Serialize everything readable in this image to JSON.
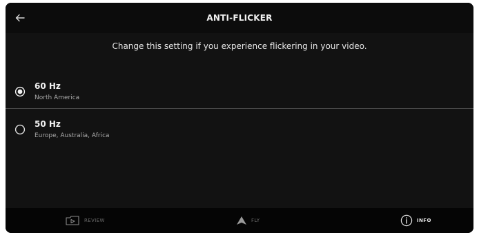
{
  "header": {
    "title": "ANTI-FLICKER",
    "back_icon": "arrow-left-icon"
  },
  "description": "Change this setting if you experience flickering in your video.",
  "options": [
    {
      "label": "60 Hz",
      "sublabel": "North America",
      "selected": true
    },
    {
      "label": "50 Hz",
      "sublabel": "Europe, Australia, Africa",
      "selected": false
    }
  ],
  "bottom_nav": [
    {
      "label": "REVIEW",
      "icon": "review-play-icon",
      "active": false
    },
    {
      "label": "FLY",
      "icon": "fly-arrow-icon",
      "active": false
    },
    {
      "label": "INFO",
      "icon": "info-icon",
      "active": true
    }
  ],
  "colors": {
    "background": "#121212",
    "header": "#0c0c0c",
    "bottom_bar": "#050505",
    "text_primary": "#f2f2f2",
    "text_secondary": "#a8a8a8",
    "inactive_nav": "#6c6c6c"
  }
}
